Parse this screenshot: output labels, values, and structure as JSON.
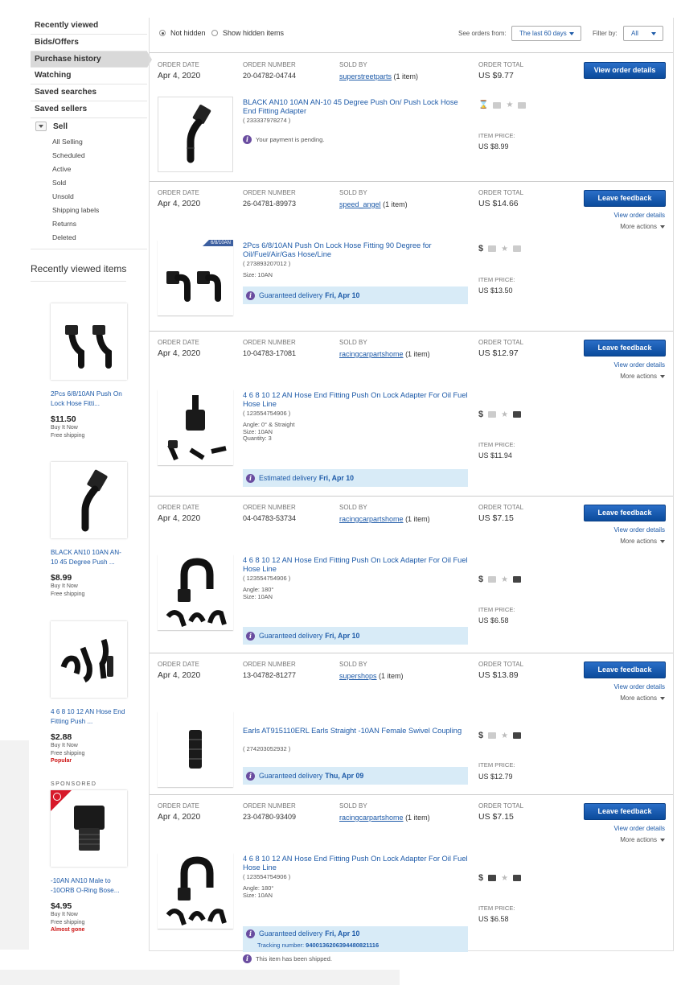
{
  "sidebar": {
    "nav": [
      "Recently viewed",
      "Bids/Offers",
      "Purchase history",
      "Watching",
      "Saved searches",
      "Saved sellers"
    ],
    "sell_label": "Sell",
    "sell_items": [
      "All Selling",
      "Scheduled",
      "Active",
      "Sold",
      "Unsold",
      "Shipping labels",
      "Returns",
      "Deleted"
    ],
    "recent_title": "Recently viewed items",
    "recent": [
      {
        "title": "2Pcs 6/8/10AN Push On Lock Hose Fitti...",
        "price": "$11.50",
        "format": "Buy It Now",
        "shipping": "Free shipping",
        "tag": ""
      },
      {
        "title": "BLACK AN10 10AN AN-10 45 Degree Push ...",
        "price": "$8.99",
        "format": "Buy It Now",
        "shipping": "Free shipping",
        "tag": ""
      },
      {
        "title": "4 6 8 10 12 AN Hose End Fitting Push ...",
        "price": "$2.88",
        "format": "Buy It Now",
        "shipping": "Free shipping",
        "tag": "Popular"
      }
    ],
    "sponsored_label": "SPONSORED",
    "sponsored": {
      "title": "-10AN AN10 Male to -10ORB O-Ring Bose...",
      "price": "$4.95",
      "format": "Buy It Now",
      "shipping": "Free shipping",
      "tag": "Almost gone"
    }
  },
  "filters": {
    "not_hidden": "Not hidden",
    "show_hidden": "Show hidden items",
    "see_orders_label": "See orders from:",
    "range": "The last 60 days",
    "filter_label": "Filter by:",
    "filter_value": "All"
  },
  "labels": {
    "order_date": "ORDER DATE",
    "order_number": "ORDER NUMBER",
    "sold_by": "SOLD BY",
    "order_total": "ORDER TOTAL",
    "item_price": "ITEM PRICE:",
    "view_order_details": "View order details",
    "leave_feedback": "Leave feedback",
    "more_actions": "More actions"
  },
  "orders": [
    {
      "date": "Apr 4, 2020",
      "number": "20-04782-04744",
      "seller": "superstreetparts",
      "count": "(1 item)",
      "total": "US $9.77",
      "title": "BLACK AN10 10AN AN-10 45 Degree Push On/ Push Lock Hose End Fitting Adapter",
      "item_no": "( 233337978274 )",
      "specs": [],
      "notice": "Your payment is pending.",
      "delivery": "",
      "delivery_date": "",
      "tracking_label": "",
      "tracking": "",
      "item_price": "US $8.99",
      "ribbon": ""
    },
    {
      "date": "Apr 4, 2020",
      "number": "26-04781-89973",
      "seller": "speed_angel",
      "count": "(1 item)",
      "total": "US $14.66",
      "title": "2Pcs 6/8/10AN Push On Lock Hose Fitting 90 Degree for Oil/Fuel/Air/Gas Hose/Line",
      "item_no": "( 273893207012 )",
      "specs": [
        "Size: 10AN"
      ],
      "notice": "",
      "delivery": "Guaranteed delivery",
      "delivery_date": "Fri, Apr 10",
      "tracking_label": "",
      "tracking": "",
      "item_price": "US $13.50",
      "ribbon": "6/8/10AN"
    },
    {
      "date": "Apr 4, 2020",
      "number": "10-04783-17081",
      "seller": "racingcarpartshome",
      "count": "(1 item)",
      "total": "US $12.97",
      "title": "4 6 8 10 12 AN Hose End Fitting Push On Lock Adapter For Oil Fuel Hose Line",
      "item_no": "( 123554754906 )",
      "specs": [
        "Angle: 0° & Straight",
        "Size: 10AN",
        "Quantity: 3"
      ],
      "notice": "",
      "delivery": "Estimated delivery",
      "delivery_date": "Fri, Apr 10",
      "tracking_label": "",
      "tracking": "",
      "item_price": "US $11.94",
      "ribbon": ""
    },
    {
      "date": "Apr 4, 2020",
      "number": "04-04783-53734",
      "seller": "racingcarpartshome",
      "count": "(1 item)",
      "total": "US $7.15",
      "title": "4 6 8 10 12 AN Hose End Fitting Push On Lock Adapter For Oil Fuel Hose Line",
      "item_no": "( 123554754906 )",
      "specs": [
        "Angle: 180°",
        "Size: 10AN"
      ],
      "notice": "",
      "delivery": "Guaranteed delivery",
      "delivery_date": "Fri, Apr 10",
      "tracking_label": "",
      "tracking": "",
      "item_price": "US $6.58",
      "ribbon": ""
    },
    {
      "date": "Apr 4, 2020",
      "number": "13-04782-81277",
      "seller": "supershops",
      "count": "(1 item)",
      "total": "US $13.89",
      "title": "Earls AT915110ERL Earls Straight -10AN Female Swivel Coupling",
      "item_no": "( 274203052932 )",
      "specs": [],
      "notice": "",
      "delivery": "Guaranteed delivery",
      "delivery_date": "Thu, Apr 09",
      "tracking_label": "",
      "tracking": "",
      "item_price": "US $12.79",
      "ribbon": ""
    },
    {
      "date": "Apr 4, 2020",
      "number": "23-04780-93409",
      "seller": "racingcarpartshome",
      "count": "(1 item)",
      "total": "US $7.15",
      "title": "4 6 8 10 12 AN Hose End Fitting Push On Lock Adapter For Oil Fuel Hose Line",
      "item_no": "( 123554754906 )",
      "specs": [
        "Angle: 180°",
        "Size: 10AN"
      ],
      "notice": "This item has been shipped.",
      "delivery": "Guaranteed delivery",
      "delivery_date": "Fri, Apr 10",
      "tracking_label": "Tracking number:",
      "tracking": "9400136206394480821116",
      "item_price": "US $6.58",
      "ribbon": ""
    }
  ]
}
